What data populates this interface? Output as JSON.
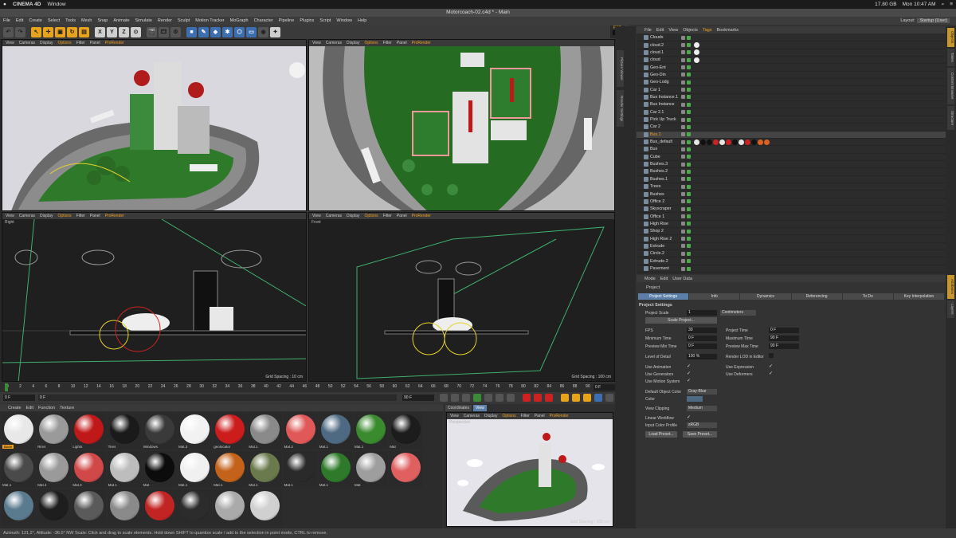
{
  "mac_menu": {
    "apple_icon": "apple-icon",
    "app_name": "CINEMA 4D",
    "window_menu": "Window",
    "battery": "17.80 GB",
    "clock": "Mon 10:47 AM"
  },
  "window_title": "Motorcoach-02.c4d * - Main",
  "menu": {
    "items": [
      "File",
      "Edit",
      "Create",
      "Select",
      "Tools",
      "Mesh",
      "Snap",
      "Animate",
      "Simulate",
      "Render",
      "Sculpt",
      "Motion Tracker",
      "MoGraph",
      "Character",
      "Pipeline",
      "Plugins",
      "Script",
      "Window",
      "Help"
    ],
    "layout_label": "Layout:",
    "layout_value": "Startup (User)"
  },
  "toolbar": {
    "x_label": "X",
    "y_label": "Y",
    "z_label": "Z"
  },
  "viewports": {
    "menu": [
      "View",
      "Cameras",
      "Display",
      "Options",
      "Filter",
      "Panel",
      "ProRender"
    ],
    "bottom_left_label": "Right",
    "bottom_right_label": "Front",
    "grid_spacing_left": "Grid Spacing : 10 cm",
    "grid_spacing_right": "Grid Spacing : 100 cm",
    "psr_label": "PSR",
    "psr_value": "0"
  },
  "object_manager": {
    "menu": [
      "File",
      "Edit",
      "View",
      "Objects",
      "Tags",
      "Bookmarks"
    ],
    "objects": [
      {
        "name": "Clouds",
        "selected": false
      },
      {
        "name": "cloud.2",
        "selected": false
      },
      {
        "name": "cloud.1",
        "selected": false
      },
      {
        "name": "cloud",
        "selected": false
      },
      {
        "name": "Geo-Ent",
        "selected": false
      },
      {
        "name": "Geo-Din",
        "selected": false
      },
      {
        "name": "Geo-Lodg",
        "selected": false
      },
      {
        "name": "Car 1",
        "selected": false
      },
      {
        "name": "Bus Instance.1",
        "selected": false
      },
      {
        "name": "Bus Instance",
        "selected": false
      },
      {
        "name": "Car 2.1",
        "selected": false
      },
      {
        "name": "Pick Up Truck",
        "selected": false
      },
      {
        "name": "Car 2",
        "selected": false
      },
      {
        "name": "Bus.1",
        "selected": true
      },
      {
        "name": "Bus_default",
        "selected": false
      },
      {
        "name": "Bus",
        "selected": false
      },
      {
        "name": "Cube",
        "selected": false
      },
      {
        "name": "Bushes.3",
        "selected": false
      },
      {
        "name": "Bushes.2",
        "selected": false
      },
      {
        "name": "Bushes.1",
        "selected": false
      },
      {
        "name": "Trees",
        "selected": false
      },
      {
        "name": "Bushes",
        "selected": false
      },
      {
        "name": "Office 2",
        "selected": false
      },
      {
        "name": "Skyscraper",
        "selected": false
      },
      {
        "name": "Office 1",
        "selected": false
      },
      {
        "name": "High Rise",
        "selected": false
      },
      {
        "name": "Shop 2",
        "selected": false
      },
      {
        "name": "High Rise 2",
        "selected": false
      },
      {
        "name": "Extrude",
        "selected": false
      },
      {
        "name": "Circle.2",
        "selected": false
      },
      {
        "name": "Extrude.2",
        "selected": false
      },
      {
        "name": "Pavement",
        "selected": false
      }
    ]
  },
  "attributes": {
    "menu": [
      "Mode",
      "Edit",
      "User Data"
    ],
    "object_label": "Project",
    "tabs": [
      "Project Settings",
      "Info",
      "Dynamics",
      "Referencing",
      "To Do",
      "Key Interpolation"
    ],
    "section_title": "Project Settings",
    "project_scale_label": "Project Scale",
    "project_scale_value": "1",
    "project_scale_unit": "Centimeters",
    "scale_project_button": "Scale Project...",
    "fps_label": "FPS",
    "fps_value": "30",
    "project_time_label": "Project Time",
    "project_time_value": "0 F",
    "min_time_label": "Minimum Time",
    "min_time_value": "0 F",
    "max_time_label": "Maximum Time",
    "max_time_value": "90 F",
    "preview_min_label": "Preview Min Time",
    "preview_min_value": "0 F",
    "preview_max_label": "Preview Max Time",
    "preview_max_value": "90 F",
    "lod_label": "Level of Detail",
    "lod_value": "100 %",
    "render_lod_label": "Render LOD in Editor",
    "use_animation_label": "Use Animation",
    "use_expression_label": "Use Expression",
    "use_generators_label": "Use Generators",
    "use_deformers_label": "Use Deformers",
    "use_motion_label": "Use Motion System",
    "default_color_label": "Default Object Color",
    "default_color_value": "Gray-Blue",
    "color_label": "Color",
    "view_clipping_label": "View Clipping",
    "view_clipping_value": "Medium",
    "linear_workflow_label": "Linear Workflow",
    "input_color_label": "Input Color Profile",
    "input_color_value": "sRGB",
    "load_preset_button": "Load Preset...",
    "save_preset_button": "Save Preset...",
    "check_mark": "✓"
  },
  "timeline": {
    "ticks": [
      "0",
      "2",
      "4",
      "6",
      "8",
      "10",
      "12",
      "14",
      "16",
      "18",
      "20",
      "22",
      "24",
      "26",
      "28",
      "30",
      "32",
      "34",
      "36",
      "38",
      "40",
      "42",
      "44",
      "46",
      "48",
      "50",
      "52",
      "54",
      "56",
      "58",
      "60",
      "62",
      "64",
      "66",
      "68",
      "70",
      "72",
      "74",
      "76",
      "78",
      "80",
      "82",
      "84",
      "86",
      "88",
      "90"
    ],
    "end_frame": "0 F"
  },
  "transport": {
    "start_field": "0 F",
    "current_field": "0 F",
    "end_field": "90 F",
    "max_field": "90 F"
  },
  "material_manager": {
    "menu": [
      "Create",
      "Edit",
      "Function",
      "Texture"
    ],
    "materials": [
      {
        "name": "Base",
        "color": "#e8e8e8",
        "active": true
      },
      {
        "name": "Rims",
        "color": "#9a9a9a",
        "active": false
      },
      {
        "name": "Lights",
        "color": "#c01818",
        "active": false
      },
      {
        "name": "Tires",
        "color": "#1a1a1a",
        "active": false
      },
      {
        "name": "Windows",
        "color": "#3a3a3a",
        "active": false
      },
      {
        "name": "Mat.3",
        "color": "#f2f2f2",
        "active": false
      },
      {
        "name": "geolocator",
        "color": "#cc1c1c",
        "active": false
      },
      {
        "name": "Mat.1",
        "color": "#8a8a8a",
        "active": false
      },
      {
        "name": "Mat.2",
        "color": "#e05858",
        "active": false
      },
      {
        "name": "Mat.1",
        "color": "#4e6a82",
        "active": false
      },
      {
        "name": "Mat.1",
        "color": "#3a8a2e",
        "active": false
      },
      {
        "name": "Mat",
        "color": "#1c1c1c",
        "active": false
      },
      {
        "name": "Mat.1",
        "color": "#4a4a4a",
        "active": false
      },
      {
        "name": "Mat.4",
        "color": "#9a9a9a",
        "active": false
      },
      {
        "name": "Mat.3",
        "color": "#d04848",
        "active": false
      },
      {
        "name": "Mat.1",
        "color": "#bdbdbd",
        "active": false
      },
      {
        "name": "Mat",
        "color": "#0c0c0c",
        "active": false
      },
      {
        "name": "Mat.1",
        "color": "#f0f0f0",
        "active": false
      },
      {
        "name": "Mat.1",
        "color": "#c4621a",
        "active": false
      },
      {
        "name": "Mat.1",
        "color": "#6b7a4c",
        "active": false
      },
      {
        "name": "Mat.1",
        "color": "#2a2a2a",
        "active": false
      },
      {
        "name": "Mat.1",
        "color": "#2e7a2a",
        "active": false
      },
      {
        "name": "Mat",
        "color": "#9e9e9e",
        "active": false
      },
      {
        "name": "",
        "color": "#e06060",
        "active": false
      },
      {
        "name": "",
        "color": "#5a7a8e",
        "active": false
      },
      {
        "name": "",
        "color": "#1e1e1e",
        "active": false
      },
      {
        "name": "",
        "color": "#5a5a5a",
        "active": false
      },
      {
        "name": "",
        "color": "#8a8a8a",
        "active": false
      },
      {
        "name": "",
        "color": "#c22424",
        "active": false
      },
      {
        "name": "",
        "color": "#2c2c2c",
        "active": false
      },
      {
        "name": "",
        "color": "#aaaaaa",
        "active": false
      },
      {
        "name": "",
        "color": "#d0d0d0",
        "active": false
      }
    ]
  },
  "preview_panel": {
    "tabs": [
      "Coordinates",
      "View"
    ],
    "menu": [
      "View",
      "Cameras",
      "Display",
      "Options",
      "Filter",
      "Panel",
      "ProRender"
    ],
    "label": "Perspective",
    "grid_spacing": "Grid Spacing : 100 cm"
  },
  "right_tabs": [
    "Objects",
    "Takes",
    "Content Browser",
    "Structure"
  ],
  "mid_tabs": [
    "Picture Viewer",
    "Render Settings"
  ],
  "attr_side_tabs": [
    "Attributes",
    "Layers"
  ],
  "status_text": "Azimuth: 121.2°, Altitude: -36.0° NW    Scale: Click and drag to scale elements. Hold down SHIFT to quantize scale / add to the selection in point mode, CTRL to remove.",
  "colors": {
    "accent": "#f0a020",
    "selection_blue": "#5b7fa8",
    "field_bg": "#1f1f1f"
  }
}
